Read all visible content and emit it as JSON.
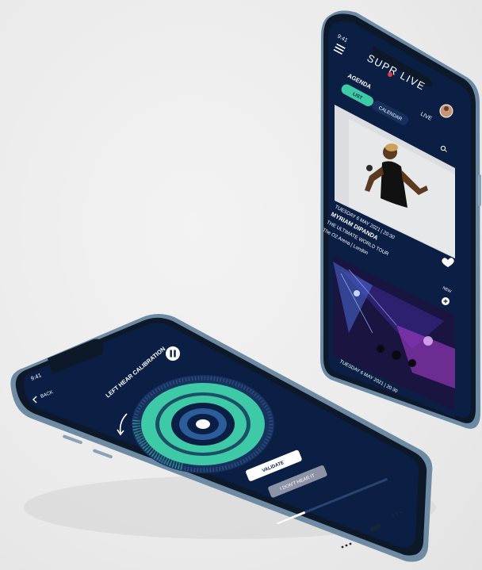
{
  "right_phone": {
    "status_time": "9:41",
    "app_logo": "SUPR LIVE",
    "logo_accent": "•",
    "section_title": "AGENDA",
    "tabs": [
      {
        "label": "LIST",
        "icon": "list-icon",
        "active": true
      },
      {
        "label": "CALENDAR",
        "icon": "calendar-icon",
        "active": false
      }
    ],
    "live_label": "LIVE",
    "event1": {
      "date": "TUESDAY 6 MAY 2021 | 20:30",
      "artist": "MYRIAM DIPANDA",
      "tour": "THE ULTIMATE WORLD TOUR",
      "venue": "The O2 Arena | London"
    },
    "event2": {
      "badge": "NEW",
      "date": "TUESDAY 6 MAY 2021 | 20:30"
    },
    "colors": {
      "bg": "#0b1f45",
      "accent": "#3ec9a7"
    }
  },
  "left_phone": {
    "status_time": "9:41",
    "back_label": "BACK",
    "title": "LEFT HEAR CALIBRATION",
    "validate_label": "VALIDATE",
    "dont_hear_label": "I DON'T HEAR IT",
    "icons": [
      "back-arrow-icon",
      "pause-icon",
      "rotate-arrow-icon"
    ],
    "colors": {
      "bg": "#0b1f45",
      "ring": "#3ec9a7",
      "ring_dark": "#1c4f66"
    }
  }
}
